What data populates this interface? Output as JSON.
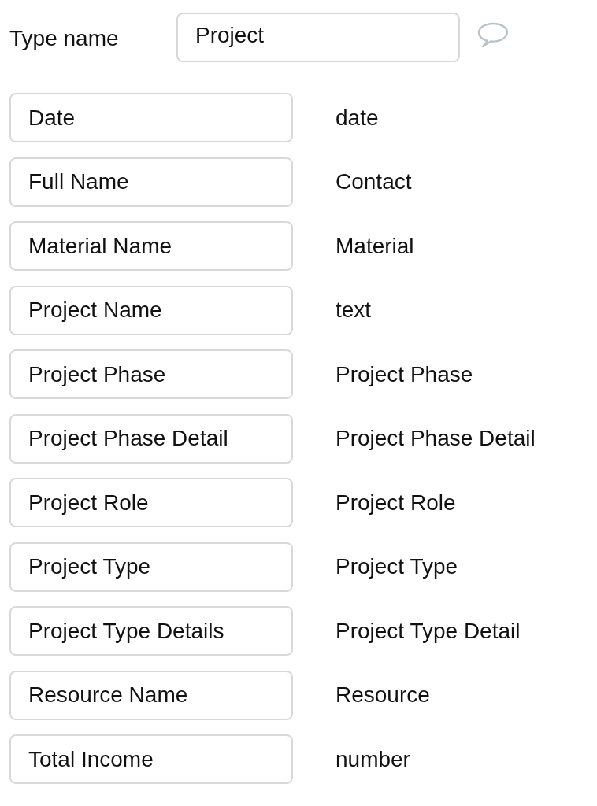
{
  "type_name": {
    "label": "Type name",
    "value": "Project"
  },
  "fields": [
    {
      "name": "Date",
      "type": "date"
    },
    {
      "name": "Full Name",
      "type": "Contact"
    },
    {
      "name": "Material Name",
      "type": "Material"
    },
    {
      "name": "Project Name",
      "type": "text"
    },
    {
      "name": "Project Phase",
      "type": "Project Phase"
    },
    {
      "name": "Project Phase Detail",
      "type": "Project Phase Detail"
    },
    {
      "name": "Project Role",
      "type": "Project Role"
    },
    {
      "name": "Project Type",
      "type": "Project Type"
    },
    {
      "name": "Project Type Details",
      "type": "Project Type Detail"
    },
    {
      "name": "Resource Name",
      "type": "Resource"
    },
    {
      "name": "Total Income",
      "type": "number"
    }
  ]
}
